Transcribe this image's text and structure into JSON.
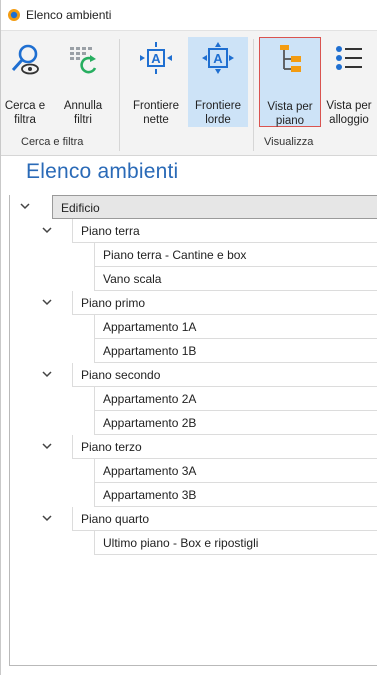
{
  "window": {
    "title": "Elenco ambienti"
  },
  "ribbon": {
    "buttons": [
      {
        "label": "Cerca e\nfiltra",
        "icon": "search-filter-icon"
      },
      {
        "label": "Annulla\nfiltri",
        "icon": "clear-filter-icon"
      },
      {
        "label": "Frontiere\nnette",
        "icon": "frontier-net-icon"
      },
      {
        "label": "Frontiere\nlorde",
        "icon": "frontier-gross-icon"
      },
      {
        "label": "Vista per\npiano",
        "icon": "view-by-floor-icon"
      },
      {
        "label": "Vista per\nalloggio",
        "icon": "view-by-unit-icon"
      }
    ],
    "groups": [
      {
        "label": "Cerca e filtra"
      },
      {
        "label": "Visualizza"
      }
    ]
  },
  "heading": "Elenco ambienti",
  "tree": {
    "root": "Edificio",
    "floors": [
      {
        "label": "Piano terra",
        "items": [
          "Piano terra - Cantine e box",
          "Vano scala"
        ]
      },
      {
        "label": "Piano primo",
        "items": [
          "Appartamento 1A",
          "Appartamento 1B"
        ]
      },
      {
        "label": "Piano secondo",
        "items": [
          "Appartamento 2A",
          "Appartamento 2B"
        ]
      },
      {
        "label": "Piano terzo",
        "items": [
          "Appartamento 3A",
          "Appartamento 3B"
        ]
      },
      {
        "label": "Piano quarto",
        "items": [
          "Ultimo piano - Box e ripostigli"
        ]
      }
    ]
  },
  "colors": {
    "accent": "#2a6ab7",
    "pressed": "#cde3f7",
    "highlight_border": "#d9534f",
    "icon_orange": "#f39c12",
    "icon_blue": "#1f6fd1"
  }
}
